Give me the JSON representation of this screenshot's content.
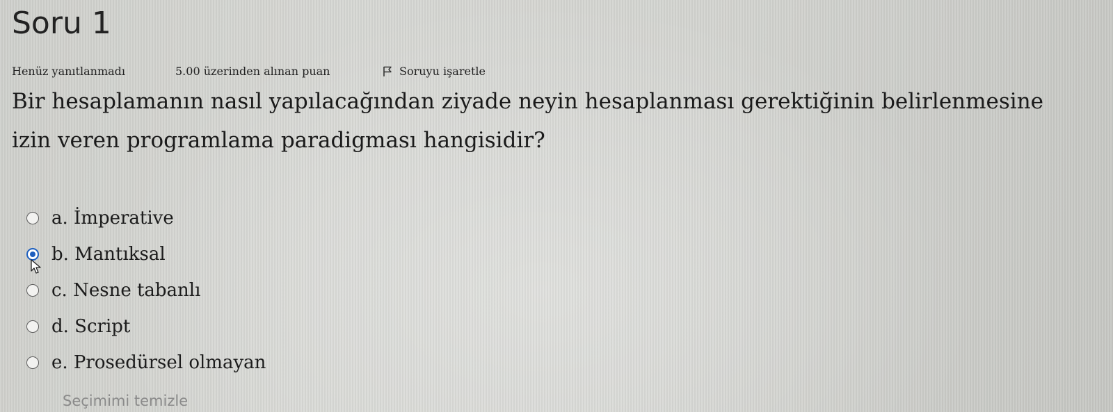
{
  "question": {
    "title": "Soru 1",
    "status": "Henüz yanıtlanmadı",
    "points": "5.00 üzerinden alınan puan",
    "flag_label": "Soruyu işaretle",
    "text_line1": "Bir hesaplamanın nasıl yapılacağından ziyade neyin hesaplanması gerektiğinin belirlenmesine",
    "text_line2": "izin veren programlama paradigması hangisidir?"
  },
  "answers": [
    {
      "label": "a. İmperative",
      "selected": false
    },
    {
      "label": "b. Mantıksal",
      "selected": true
    },
    {
      "label": "c. Nesne tabanlı",
      "selected": false
    },
    {
      "label": "d. Script",
      "selected": false
    },
    {
      "label": "e. Prosedürsel olmayan",
      "selected": false
    }
  ],
  "clear_label": "Seçimimi temizle",
  "icons": {
    "flag": "flag-icon",
    "cursor": "mouse-pointer-icon"
  },
  "colors": {
    "selected_radio": "#1e5fbf",
    "background": "#d3d4d0"
  }
}
